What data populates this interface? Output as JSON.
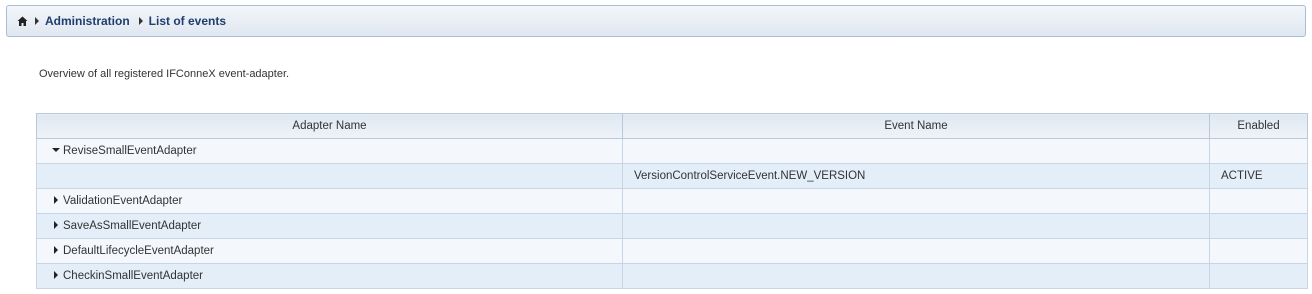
{
  "breadcrumb": {
    "home_icon": "home-icon",
    "items": [
      {
        "label": "Administration"
      },
      {
        "label": "List of events"
      }
    ]
  },
  "description": "Overview of all registered IFConneX event-adapter.",
  "table": {
    "columns": [
      "Adapter Name",
      "Event Name",
      "Enabled"
    ],
    "rows": [
      {
        "adapter": "ReviseSmallEventAdapter",
        "event": "",
        "enabled": "",
        "expanded": true
      },
      {
        "adapter": "",
        "event": "VersionControlServiceEvent.NEW_VERSION",
        "enabled": "ACTIVE",
        "child": true
      },
      {
        "adapter": "ValidationEventAdapter",
        "event": "",
        "enabled": "",
        "expanded": false
      },
      {
        "adapter": "SaveAsSmallEventAdapter",
        "event": "",
        "enabled": "",
        "expanded": false
      },
      {
        "adapter": "DefaultLifecycleEventAdapter",
        "event": "",
        "enabled": "",
        "expanded": false
      },
      {
        "adapter": "CheckinSmallEventAdapter",
        "event": "",
        "enabled": "",
        "expanded": false
      }
    ]
  },
  "colors": {
    "link": "#1f3d6e",
    "header_bg": "#dfe8f2",
    "row_light": "#f4f8fc",
    "row_dark": "#e4eef8"
  }
}
